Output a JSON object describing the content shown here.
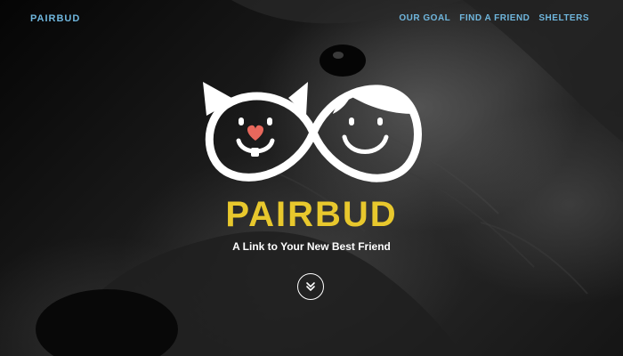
{
  "brand": {
    "name": "PAIRBUD"
  },
  "nav": {
    "items": [
      {
        "label": "OUR GOAL"
      },
      {
        "label": "FIND A FRIEND"
      },
      {
        "label": "SHELTERS"
      }
    ]
  },
  "hero": {
    "title": "PAIRBUD",
    "tagline": "A Link to Your New Best Friend",
    "scroll_icon": "double-chevron-down-icon"
  },
  "colors": {
    "accent": "#e8c82d",
    "nav_text": "#6fb6dd",
    "heart": "#e8685c",
    "logo_stroke": "#ffffff"
  }
}
